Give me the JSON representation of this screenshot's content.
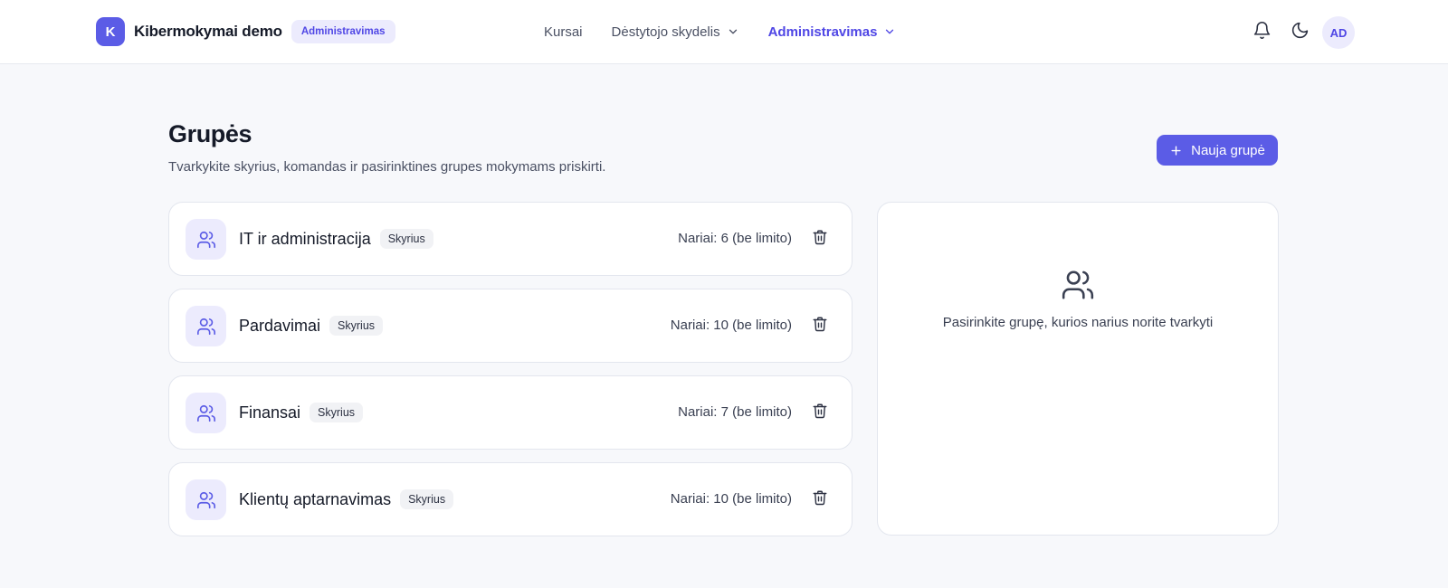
{
  "header": {
    "logo_letter": "K",
    "app_name": "Kibermokymai demo",
    "role_badge": "Administravimas",
    "nav": [
      {
        "label": "Kursai"
      },
      {
        "label": "Dėstytojo skydelis"
      },
      {
        "label": "Administravimas"
      }
    ],
    "avatar_initials": "AD",
    "icons": {
      "notifications": "bell-icon",
      "theme": "moon-icon"
    }
  },
  "page": {
    "title": "Grupės",
    "subtitle": "Tvarkykite skyrius, komandas ir pasirinktines grupes mokymams priskirti.",
    "new_button": "Nauja grupė"
  },
  "groups": [
    {
      "name": "IT ir administracija",
      "type": "Skyrius",
      "members": "Nariai: 6 (be limito)"
    },
    {
      "name": "Pardavimai",
      "type": "Skyrius",
      "members": "Nariai: 10 (be limito)"
    },
    {
      "name": "Finansai",
      "type": "Skyrius",
      "members": "Nariai: 7 (be limito)"
    },
    {
      "name": "Klientų aptarnavimas",
      "type": "Skyrius",
      "members": "Nariai: 10 (be limito)"
    }
  ],
  "detail": {
    "empty_text": "Pasirinkite grupę, kurios narius norite tvarkyti"
  },
  "colors": {
    "accent": "#5b5ce6",
    "accent_soft": "#ecebfd",
    "background": "#f7f8fb"
  }
}
